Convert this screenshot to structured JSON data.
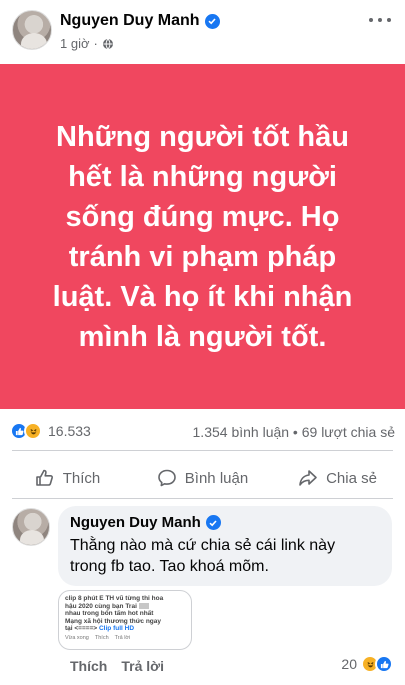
{
  "post": {
    "author": "Nguyen Duy Manh",
    "time": "1 giờ",
    "privacy_icon": "globe-icon",
    "text_lines": [
      "Những người tốt hầu",
      "hết là những người",
      "sống đúng mực. Họ",
      "tránh vi phạm pháp",
      "luật. Và họ ít khi nhận",
      "mình là người tốt."
    ],
    "background_color": "#f0475f"
  },
  "stats": {
    "reactions_count": "16.533",
    "comments_shares": "1.354 bình luận • 69 lượt chia sẻ"
  },
  "actions": {
    "like": "Thích",
    "comment": "Bình luận",
    "share": "Chia sẻ"
  },
  "comment": {
    "author": "Nguyen Duy Manh",
    "text_line1": "Thằng nào mà cứ chia sẻ cái link này",
    "text_line2": "trong fb tao. Tao khoá mõm.",
    "attachment": {
      "line1": "clip 8 phút E TH  vũ từng thi hoa",
      "line2": "hậu 2020 cùng bạn Trai",
      "line3": "nhau trong bốn tấm hot nhất",
      "line4": "Mạng xã hội thương thức ngay",
      "line5_prefix": "tại <====>",
      "line5_link": "Clip full HD",
      "meta1": "Vừa xong",
      "meta2": "Thích",
      "meta3": "Trả lời"
    },
    "like_label": "Thích",
    "reply_label": "Trả lời",
    "reaction_count": "20"
  },
  "colors": {
    "accent": "#1877f2",
    "muted": "#65676b",
    "haha": "#f7b125"
  }
}
